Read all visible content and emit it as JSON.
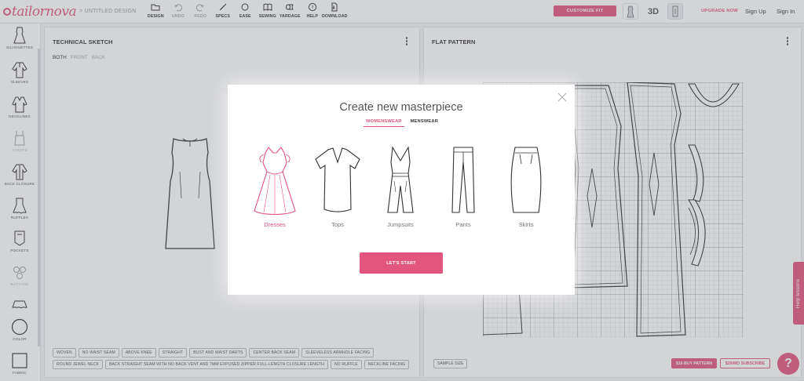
{
  "app": {
    "logo_text": "tailornova",
    "breadcrumb": "> UNTITLED DESIGN"
  },
  "toolbar": {
    "items": [
      {
        "label": "DESIGN",
        "icon": "folder-icon",
        "disabled": false
      },
      {
        "label": "UNDO",
        "icon": "undo-icon",
        "disabled": true
      },
      {
        "label": "REDO",
        "icon": "redo-icon",
        "disabled": true
      },
      {
        "label": "SPECS",
        "icon": "ruler-icon",
        "disabled": false
      },
      {
        "label": "EASE",
        "icon": "circle-icon",
        "disabled": false
      },
      {
        "label": "SEWING",
        "icon": "book-icon",
        "disabled": false
      },
      {
        "label": "YARDAGE",
        "icon": "fabric-roll-icon",
        "disabled": false
      },
      {
        "label": "HELP",
        "icon": "help-icon",
        "disabled": false
      },
      {
        "label": "DOWNLOAD",
        "icon": "download-icon",
        "disabled": false
      }
    ]
  },
  "header_right": {
    "customize_label": "CUSTOMIZE FIT",
    "view_3d_label": "3D",
    "upgrade_label": "UPGRADE NOW",
    "signup_label": "Sign Up",
    "signin_label": "Sign In"
  },
  "sidebar": {
    "items": [
      {
        "label": "SILHOUETTES",
        "icon": "dress-silhouette-icon",
        "dim": false
      },
      {
        "label": "SLEEVES",
        "icon": "sleeve-icon",
        "dim": false
      },
      {
        "label": "NECKLINES",
        "icon": "neckline-icon",
        "dim": false
      },
      {
        "label": "STRAPS",
        "icon": "straps-icon",
        "dim": true
      },
      {
        "label": "BACK CLOSURE",
        "icon": "back-closure-icon",
        "dim": false
      },
      {
        "label": "RUFFLES",
        "icon": "ruffle-icon",
        "dim": false
      },
      {
        "label": "POCKETS",
        "icon": "pocket-icon",
        "dim": false
      },
      {
        "label": "BUTTONS",
        "icon": "buttons-icon",
        "dim": true
      },
      {
        "label": "",
        "icon": "hem-icon",
        "dim": false
      },
      {
        "label": "COLOR",
        "icon": "color-circle-icon",
        "dim": false
      },
      {
        "label": "FABRIC",
        "icon": "fabric-swatch-icon",
        "dim": false
      }
    ]
  },
  "technical_sketch": {
    "title": "TECHNICAL SKETCH",
    "views": [
      "BOTH",
      "FRONT",
      "BACK"
    ],
    "active_view": "BOTH",
    "tags_row1": [
      "WOVEN",
      "NO WAIST SEAM",
      "ABOVE KNEE",
      "STRAIGHT",
      "BUST AND WAIST DARTS",
      "CENTER BACK SEAM",
      "SLEEVELESS ARMHOLE FACING"
    ],
    "tags_row2": [
      "ROUND JEWEL NECK",
      "BACK STRAIGHT SEAM WITH NO BACK VENT AND 7MM EXPOSED ZIPPER FULL-LENGTH CLOSURE LENGTH",
      "NO RUFFLE",
      "NECKLINE FACING"
    ]
  },
  "flat_pattern": {
    "title": "FLAT PATTERN",
    "sample_size_label": "SAMPLE SIZE",
    "buy_label": "$16 BUY PATTERN",
    "subscribe_label": "$29/MO SUBSCRIBE"
  },
  "help": {
    "lessons_label": "Help lessons",
    "fab_label": "?"
  },
  "modal": {
    "title": "Create new masterpiece",
    "tabs": [
      "WOMENSWEAR",
      "MENSWEAR"
    ],
    "active_tab": "WOMENSWEAR",
    "categories": [
      {
        "label": "Dresses",
        "icon": "dress-icon",
        "selected": true
      },
      {
        "label": "Tops",
        "icon": "top-icon",
        "selected": false
      },
      {
        "label": "Jumpsuits",
        "icon": "jumpsuit-icon",
        "selected": false
      },
      {
        "label": "Pants",
        "icon": "pants-icon",
        "selected": false
      },
      {
        "label": "Skirts",
        "icon": "skirt-icon",
        "selected": false
      }
    ],
    "start_label": "LET'S START"
  },
  "colors": {
    "accent": "#e2557e",
    "text": "#333333",
    "muted": "#999999"
  }
}
